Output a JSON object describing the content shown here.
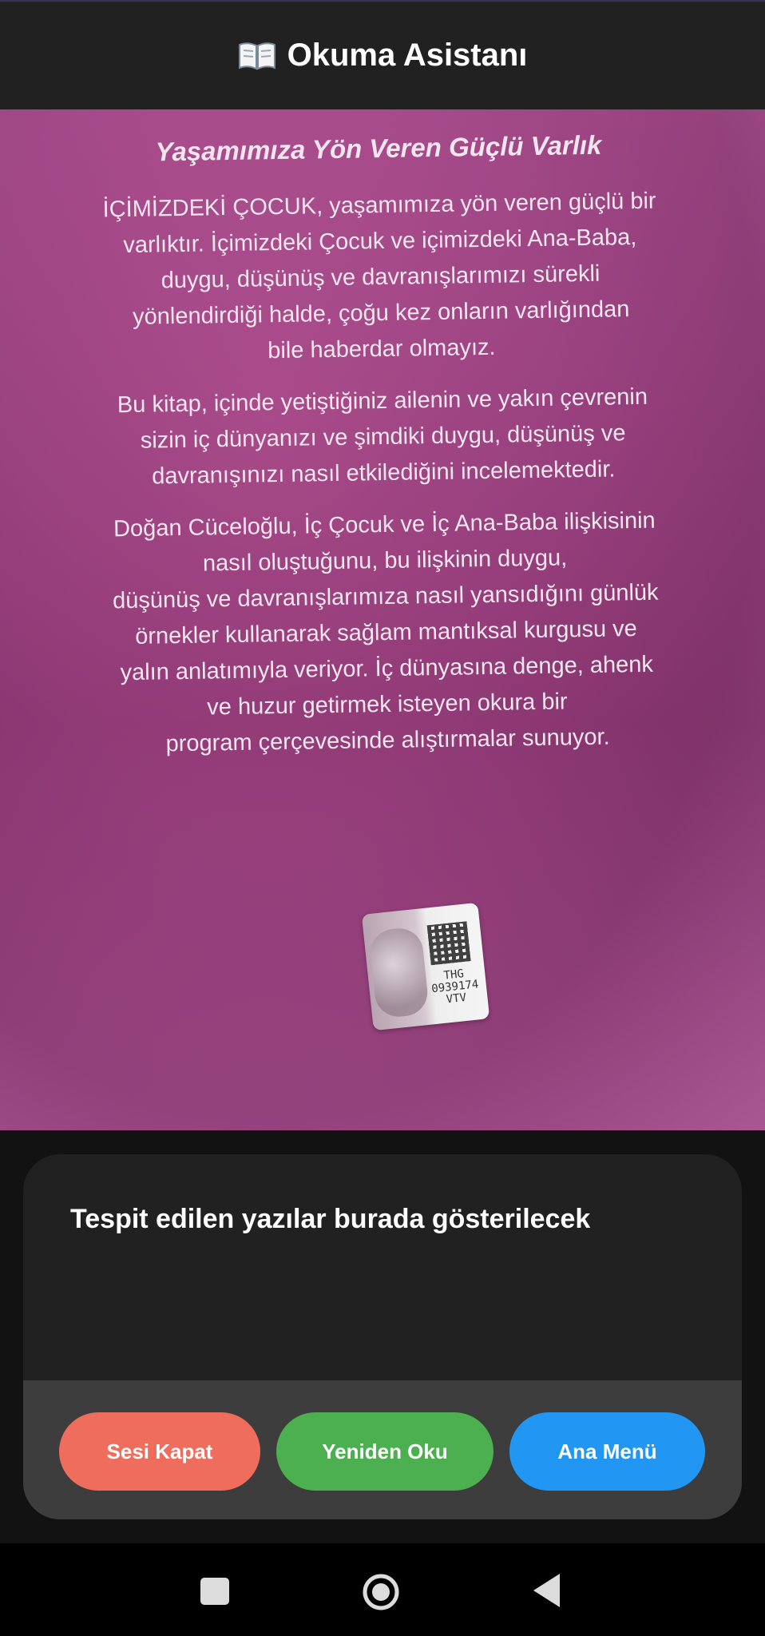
{
  "app_bar": {
    "title": "Okuma Asistanı",
    "icon": "open-book-icon"
  },
  "camera_preview": {
    "heading": "Yaşamımıza Yön Veren Güçlü Varlık",
    "paragraphs": [
      "İÇİMİZDEKİ ÇOCUK, yaşamımıza yön veren güçlü bir\nvarlıktır. İçimizdeki Çocuk ve içimizdeki Ana-Baba,\nduygu, düşünüş ve davranışlarımızı sürekli\nyönlendirdiği halde, çoğu kez onların varlığından\nbile haberdar olmayız.",
      "Bu kitap, içinde yetiştiğiniz ailenin ve yakın çevrenin\nsizin iç dünyanızı ve şimdiki duygu, düşünüş ve\ndavranışınızı nasıl etkilediğini incelemektedir.",
      "Doğan Cüceloğlu, İç Çocuk ve İç Ana-Baba ilişkisinin\nnasıl oluştuğunu, bu ilişkinin duygu,\ndüşünüş ve davranışlarımıza nasıl yansıdığını günlük\nörnekler kullanarak sağlam mantıksal kurgusu ve\nyalın anlatımıyla veriyor. İç dünyasına denge, ahenk\nve huzur getirmek isteyen okura bir\nprogram çerçevesinde alıştırmalar sunuyor."
    ],
    "sticker_code": [
      "THG",
      "0939174",
      "VTV"
    ]
  },
  "result": {
    "text": "Tespit edilen yazılar burada gösterilecek"
  },
  "buttons": {
    "mute": "Sesi Kapat",
    "reread": "Yeniden Oku",
    "menu": "Ana Menü"
  },
  "colors": {
    "mute": "#ef6d5c",
    "reread": "#4caf50",
    "menu": "#2196f3"
  }
}
